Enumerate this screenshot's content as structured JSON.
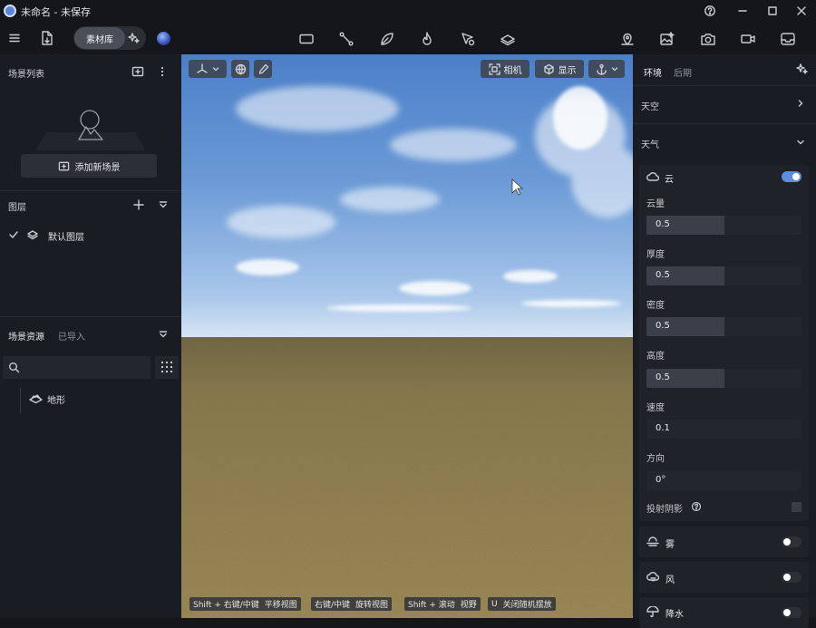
{
  "app": {
    "title": "未命名 - 未保存"
  },
  "window_controls": [
    "help-icon",
    "minimize-icon",
    "maximize-icon",
    "close-icon"
  ],
  "toolbar": {
    "asset_library": "素材库"
  },
  "left": {
    "scene_list": {
      "title": "场景列表",
      "add_button": "添加新场景"
    },
    "layers": {
      "title": "图层",
      "items": [
        {
          "label": "默认图层",
          "checked": true
        }
      ]
    },
    "assets": {
      "tab_active": "场景资源",
      "tab_other": "已导入",
      "search_placeholder": "",
      "tree": [
        {
          "label": "地形"
        }
      ]
    }
  },
  "viewport": {
    "camera_label": "相机",
    "display_label": "显示",
    "hints": [
      {
        "key": "Shift + 右键/中键",
        "action": "平移视图"
      },
      {
        "key": "右键/中键",
        "action": "旋转视图"
      },
      {
        "key": "Shift + 滚动",
        "action": "视野"
      },
      {
        "key": "U",
        "action": "关闭随机摆放"
      }
    ]
  },
  "right": {
    "tabs": [
      "环境",
      "后期"
    ],
    "sky_label": "天空",
    "weather_label": "天气",
    "cloud": {
      "label": "云",
      "enabled": true,
      "params": [
        {
          "label": "云量",
          "value": "0.5",
          "fill": 0.5
        },
        {
          "label": "厚度",
          "value": "0.5",
          "fill": 0.5
        },
        {
          "label": "密度",
          "value": "0.5",
          "fill": 0.5
        },
        {
          "label": "高度",
          "value": "0.5",
          "fill": 0.5
        },
        {
          "label": "速度",
          "value": "0.1",
          "fill": 0.0
        },
        {
          "label": "方向",
          "value": "0°",
          "fill": 0.0
        }
      ],
      "cast_shadow_label": "投射阴影"
    },
    "fog": {
      "label": "雾",
      "enabled": false
    },
    "wind": {
      "label": "风",
      "enabled": false
    },
    "precip": {
      "label": "降水",
      "enabled": false
    }
  },
  "colors": {
    "accent": "#4a7fd8",
    "panel": "#191c22",
    "toggle_on": "#5b8de0"
  }
}
